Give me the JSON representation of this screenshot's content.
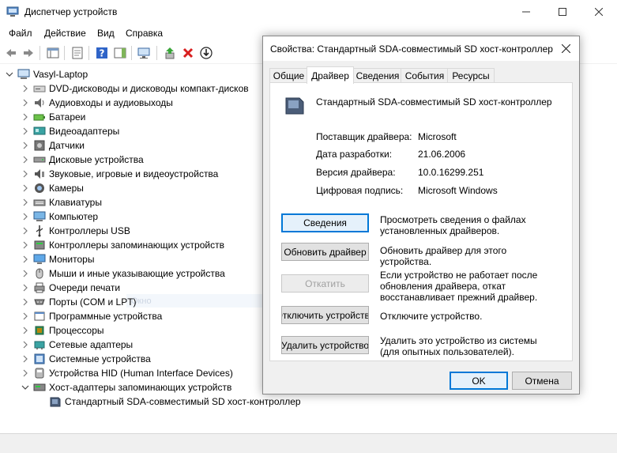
{
  "window": {
    "title": "Диспетчер устройств"
  },
  "menu": [
    "Файл",
    "Действие",
    "Вид",
    "Справка"
  ],
  "tree": {
    "root": "Vasyl-Laptop",
    "categories": [
      {
        "label": "DVD-дисководы и дисководы компакт-дисков",
        "icon": "dvd-drive-icon"
      },
      {
        "label": "Аудиовходы и аудиовыходы",
        "icon": "speaker-icon"
      },
      {
        "label": "Батареи",
        "icon": "battery-icon"
      },
      {
        "label": "Видеоадаптеры",
        "icon": "display-adapter-icon"
      },
      {
        "label": "Датчики",
        "icon": "sensor-icon"
      },
      {
        "label": "Дисковые устройства",
        "icon": "disk-drive-icon"
      },
      {
        "label": "Звуковые, игровые и видеоустройства",
        "icon": "sound-icon"
      },
      {
        "label": "Камеры",
        "icon": "camera-icon"
      },
      {
        "label": "Клавиатуры",
        "icon": "keyboard-icon"
      },
      {
        "label": "Компьютер",
        "icon": "computer-icon"
      },
      {
        "label": "Контроллеры USB",
        "icon": "usb-icon"
      },
      {
        "label": "Контроллеры запоминающих устройств",
        "icon": "storage-controller-icon"
      },
      {
        "label": "Мониторы",
        "icon": "monitor-icon"
      },
      {
        "label": "Мыши и иные указывающие устройства",
        "icon": "mouse-icon"
      },
      {
        "label": "Очереди печати",
        "icon": "printer-icon"
      },
      {
        "label": "Порты (COM и LPT)",
        "icon": "port-icon"
      },
      {
        "label": "Программные устройства",
        "icon": "software-device-icon"
      },
      {
        "label": "Процессоры",
        "icon": "processor-icon"
      },
      {
        "label": "Сетевые адаптеры",
        "icon": "network-adapter-icon"
      },
      {
        "label": "Системные устройства",
        "icon": "system-device-icon"
      },
      {
        "label": "Устройства HID (Human Interface Devices)",
        "icon": "hid-icon"
      },
      {
        "label": "Хост-адаптеры запоминающих устройств",
        "icon": "storage-host-icon"
      }
    ],
    "child": "Стандартный SDA-совместимый SD хост-контроллер",
    "ghost_text": "Окно"
  },
  "dialog": {
    "title": "Свойства: Стандартный SDA-совместимый SD хост-контроллер",
    "tabs": [
      "Общие",
      "Драйвер",
      "Сведения",
      "События",
      "Ресурсы"
    ],
    "active_tab": "Драйвер",
    "device_name": "Стандартный SDA-совместимый SD хост-контроллер",
    "props": [
      {
        "label": "Поставщик драйвера:",
        "value": "Microsoft"
      },
      {
        "label": "Дата разработки:",
        "value": "21.06.2006"
      },
      {
        "label": "Версия драйвера:",
        "value": "10.0.16299.251"
      },
      {
        "label": "Цифровая подпись:",
        "value": "Microsoft Windows"
      }
    ],
    "actions": [
      {
        "button": "Сведения",
        "desc": "Просмотреть сведения о файлах установленных драйверов.",
        "state": "default"
      },
      {
        "button": "Обновить драйвер",
        "desc": "Обновить драйвер для этого устройства.",
        "state": "normal"
      },
      {
        "button": "Откатить",
        "desc": "Если устройство не работает после обновления драйвера, откат восстанавливает прежний драйвер.",
        "state": "disabled"
      },
      {
        "button": "Отключить устройство",
        "desc": "Отключите устройство.",
        "state": "normal"
      },
      {
        "button": "Удалить устройство",
        "desc": "Удалить это устройство из системы (для опытных пользователей).",
        "state": "normal"
      }
    ],
    "ok": "OK",
    "cancel": "Отмена"
  },
  "colors": {
    "accent": "#0078d7",
    "dialog_bg": "#f0f0f0",
    "button_bg": "#e1e1e1",
    "disabled_text": "#a0a0a0"
  }
}
